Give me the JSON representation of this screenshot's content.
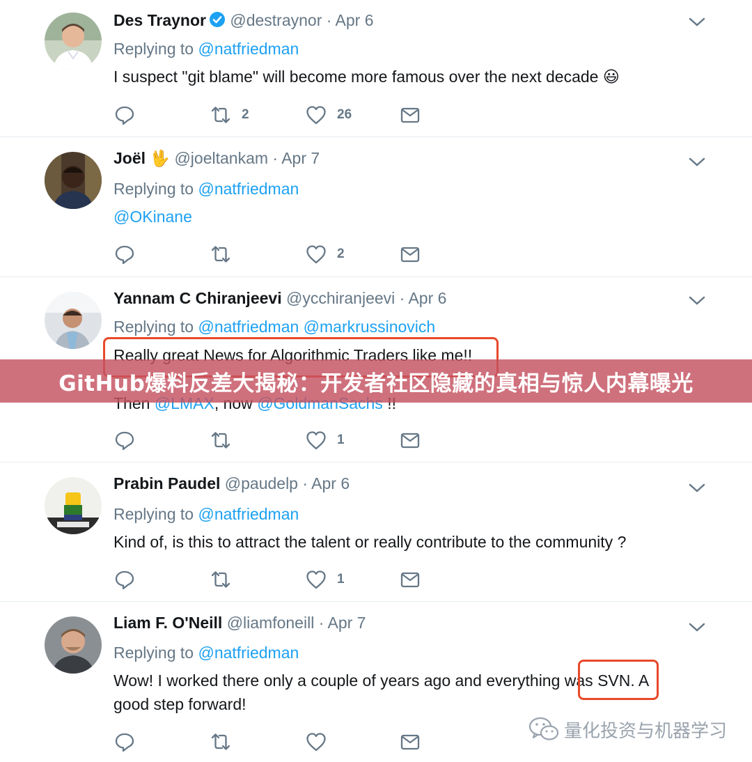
{
  "tweets": [
    {
      "name": "Des Traynor",
      "handle": "@destraynor",
      "sep": "·",
      "date": "Apr 6",
      "replying_prefix": "Replying to",
      "replying_to": [
        "@natfriedman"
      ],
      "text": "I suspect \"git blame\" will become more famous over the next decade 😃",
      "retweets": "2",
      "likes": "26",
      "verified": true
    },
    {
      "name": "Joël",
      "name_emoji": "🖖",
      "handle": "@joeltankam",
      "sep": "·",
      "date": "Apr 7",
      "replying_prefix": "Replying to",
      "replying_to": [
        "@natfriedman"
      ],
      "text_mention": "@OKinane",
      "retweets": "",
      "likes": "2"
    },
    {
      "name": "Yannam C Chiranjeevi",
      "handle": "@ycchiranjeevi",
      "sep": "·",
      "date": "Apr 6",
      "replying_prefix": "Replying to",
      "replying_to": [
        "@natfriedman",
        "@markrussinovich"
      ],
      "line1": "Really great News for Algorithmic Traders like me!!",
      "line2_prefix": "Then",
      "line2_m1": "@LMAX",
      "line2_mid": ", now",
      "line2_m2": "@GoldmanSachs",
      "line2_suffix": "!!",
      "retweets": "",
      "likes": "1"
    },
    {
      "name": "Prabin Paudel",
      "handle": "@paudelp",
      "sep": "·",
      "date": "Apr 6",
      "replying_prefix": "Replying to",
      "replying_to": [
        "@natfriedman"
      ],
      "text": "Kind of, is this to attract the talent or really contribute to the community ?",
      "retweets": "",
      "likes": "1"
    },
    {
      "name": "Liam F. O'Neill",
      "handle": "@liamfoneill",
      "sep": "·",
      "date": "Apr 7",
      "replying_prefix": "Replying to",
      "replying_to": [
        "@natfriedman"
      ],
      "line1_a": "Wow! I worked there only a couple of years ago and everything",
      "line1_b": "was SVN.",
      "line1_c": "A",
      "line2": "good step forward!",
      "retweets": "",
      "likes": ""
    }
  ],
  "banner": {
    "text": "GitHub爆料反差大揭秘：开发者社区隐藏的真相与惊人内幕曝光"
  },
  "watermark": {
    "text": "量化投资与机器学习"
  },
  "colors": {
    "link": "#1da1f2",
    "muted": "#657786",
    "highlight": "#e8492a",
    "banner": "#c45260"
  },
  "icons": [
    "reply-icon",
    "retweet-icon",
    "like-icon",
    "dm-icon",
    "caret-down-icon",
    "verified-icon",
    "wechat-icon"
  ]
}
